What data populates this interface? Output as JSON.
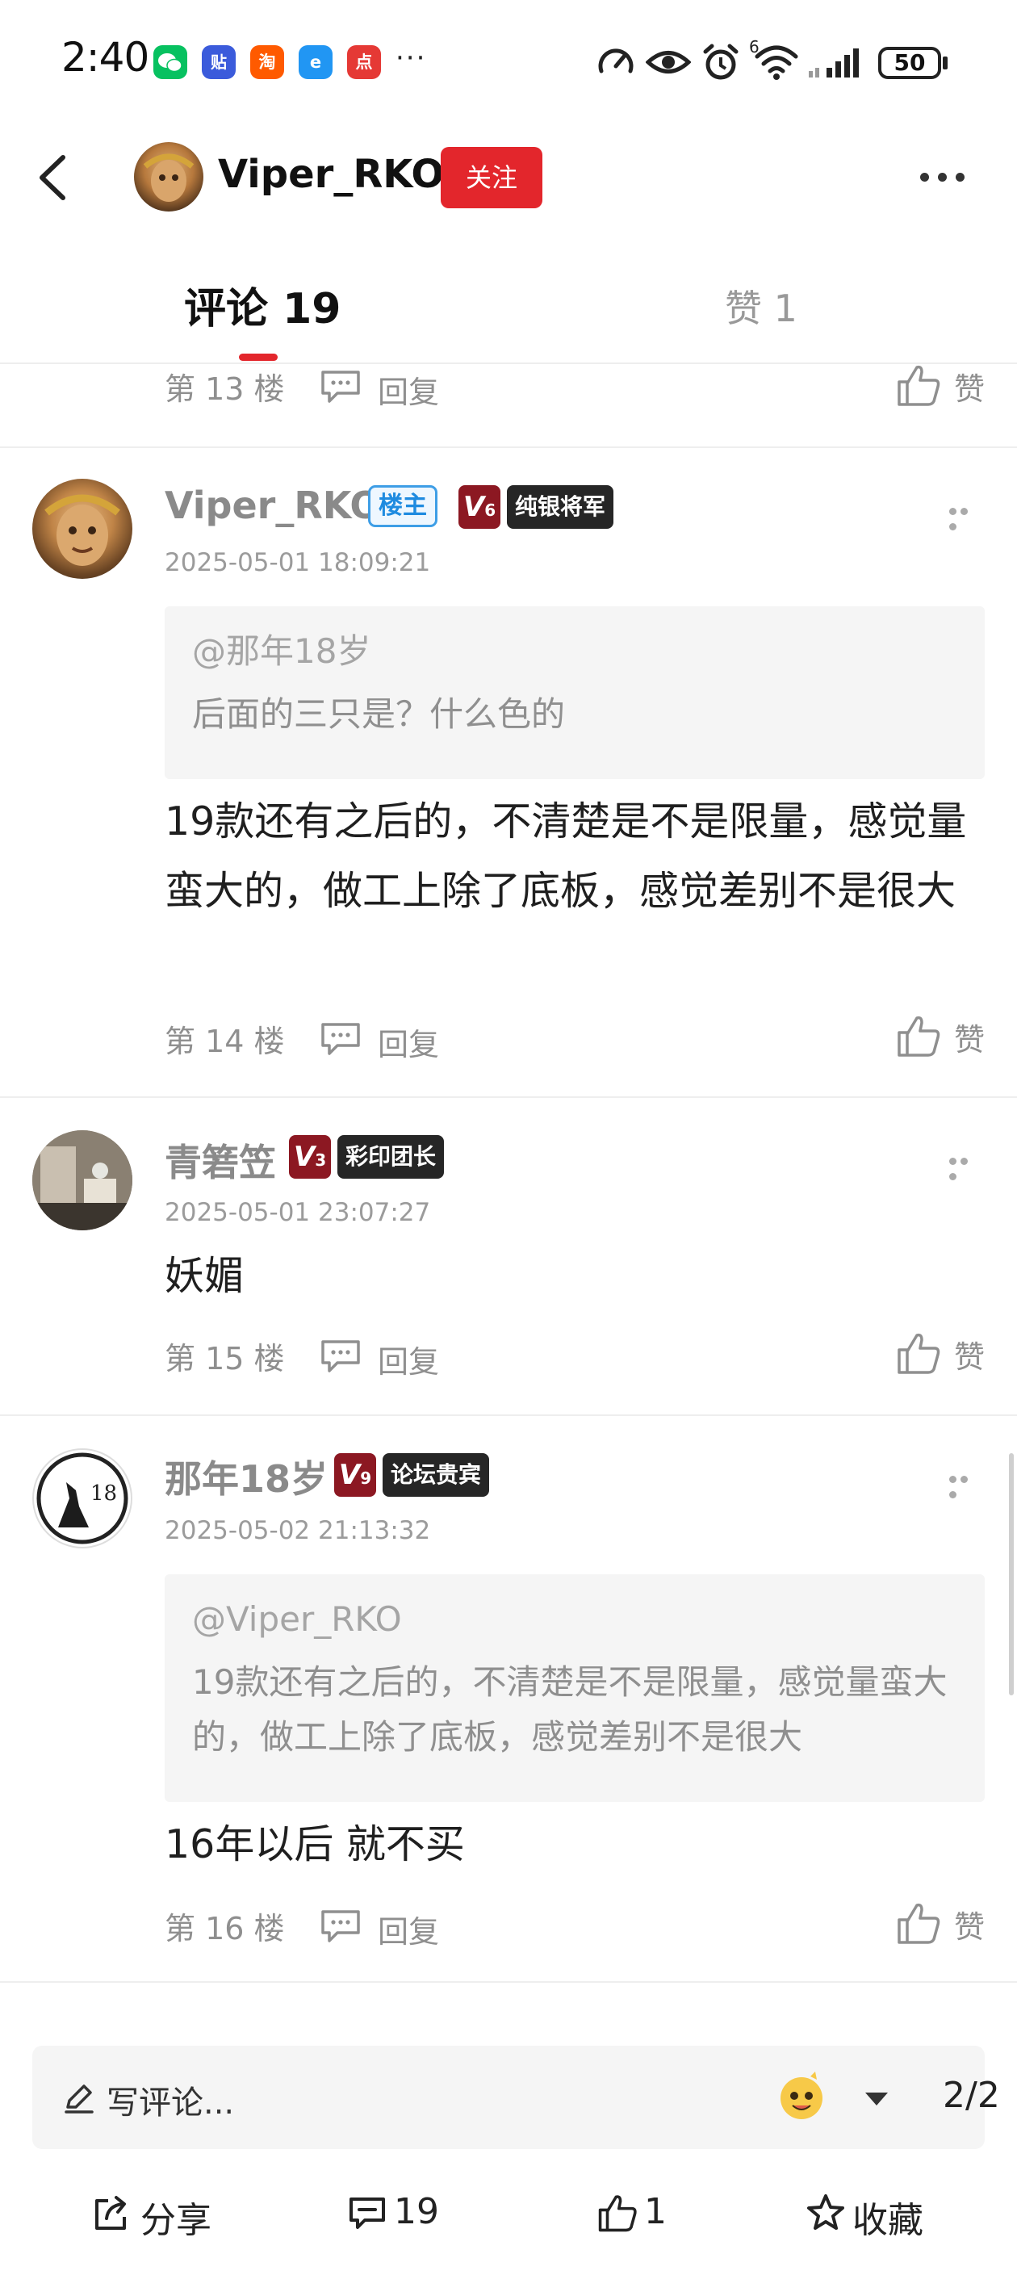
{
  "status_bar": {
    "time": "2:40",
    "apps": [
      {
        "icon": "wechat-icon",
        "glyph": "",
        "color": "#07c160"
      },
      {
        "icon": "tieba-icon",
        "glyph": "贴",
        "color": "#3b5bdb"
      },
      {
        "icon": "taobao-icon",
        "glyph": "淘",
        "color": "#ff5a00"
      },
      {
        "icon": "browser-icon",
        "glyph": "e",
        "color": "#2196f3"
      },
      {
        "icon": "dianping-icon",
        "glyph": "点",
        "color": "#e53935"
      }
    ],
    "overflow": "···",
    "network_sup": "6",
    "battery": "50"
  },
  "header": {
    "username": "Viper_RKO",
    "follow_label": "关注"
  },
  "tabs": {
    "comments_label": "评论 19",
    "likes_label": "赞 1"
  },
  "top_fragment": {
    "floor": "第 13 楼",
    "reply_label": "回复",
    "like_label": "赞"
  },
  "comments": [
    {
      "username": "Viper_RKO",
      "owner_badge": "楼主",
      "level": "V",
      "level_num": "6",
      "title_badge": "纯银将军",
      "time": "2025-05-01 18:09:21",
      "quote_user": "@那年18岁",
      "quote_text": "后面的三只是？什么色的",
      "text": "19款还有之后的，不清楚是不是限量，感觉量蛮大的，做工上除了底板，感觉差别不是很大",
      "floor": "第 14 楼",
      "reply_label": "回复",
      "like_label": "赞"
    },
    {
      "username": "青箬笠",
      "level": "V",
      "level_num": "3",
      "title_badge": "彩印团长",
      "time": "2025-05-01 23:07:27",
      "text": "妖媚",
      "floor": "第 15 楼",
      "reply_label": "回复",
      "like_label": "赞"
    },
    {
      "username": "那年18岁",
      "level": "V",
      "level_num": "9",
      "title_badge": "论坛贵宾",
      "time": "2025-05-02 21:13:32",
      "quote_user": "@Viper_RKO",
      "quote_text": "19款还有之后的，不清楚是不是限量，感觉量蛮大的，做工上除了底板，感觉差别不是很大",
      "text": "16年以后 就不买",
      "floor": "第 16 楼",
      "reply_label": "回复",
      "like_label": "赞"
    }
  ],
  "bottom": {
    "comment_placeholder": "写评论...",
    "page_indicator": "2/2",
    "share_label": "分享",
    "comment_count": "19",
    "like_count": "1",
    "collect_label": "收藏"
  }
}
